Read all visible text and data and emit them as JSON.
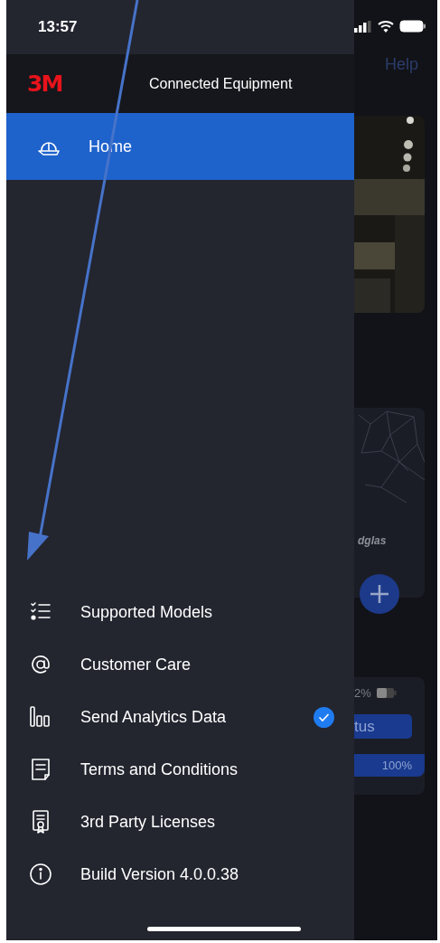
{
  "status_bar": {
    "time": "13:57"
  },
  "drawer": {
    "logo": "3M",
    "title": "Connected Equipment",
    "home": {
      "label": "Home",
      "selected": true
    },
    "items": [
      {
        "label": "Supported Models",
        "checked": false
      },
      {
        "label": "Customer Care",
        "checked": false
      },
      {
        "label": "Send Analytics Data",
        "checked": true
      },
      {
        "label": "Terms and Conditions",
        "checked": false
      },
      {
        "label": "3rd Party Licenses",
        "checked": false
      },
      {
        "label": "Build Version 4.0.0.38",
        "checked": false
      }
    ]
  },
  "background_app": {
    "help": "Help",
    "brand": "dglas",
    "battery": "2%",
    "button": "tus",
    "progress": "100%"
  }
}
